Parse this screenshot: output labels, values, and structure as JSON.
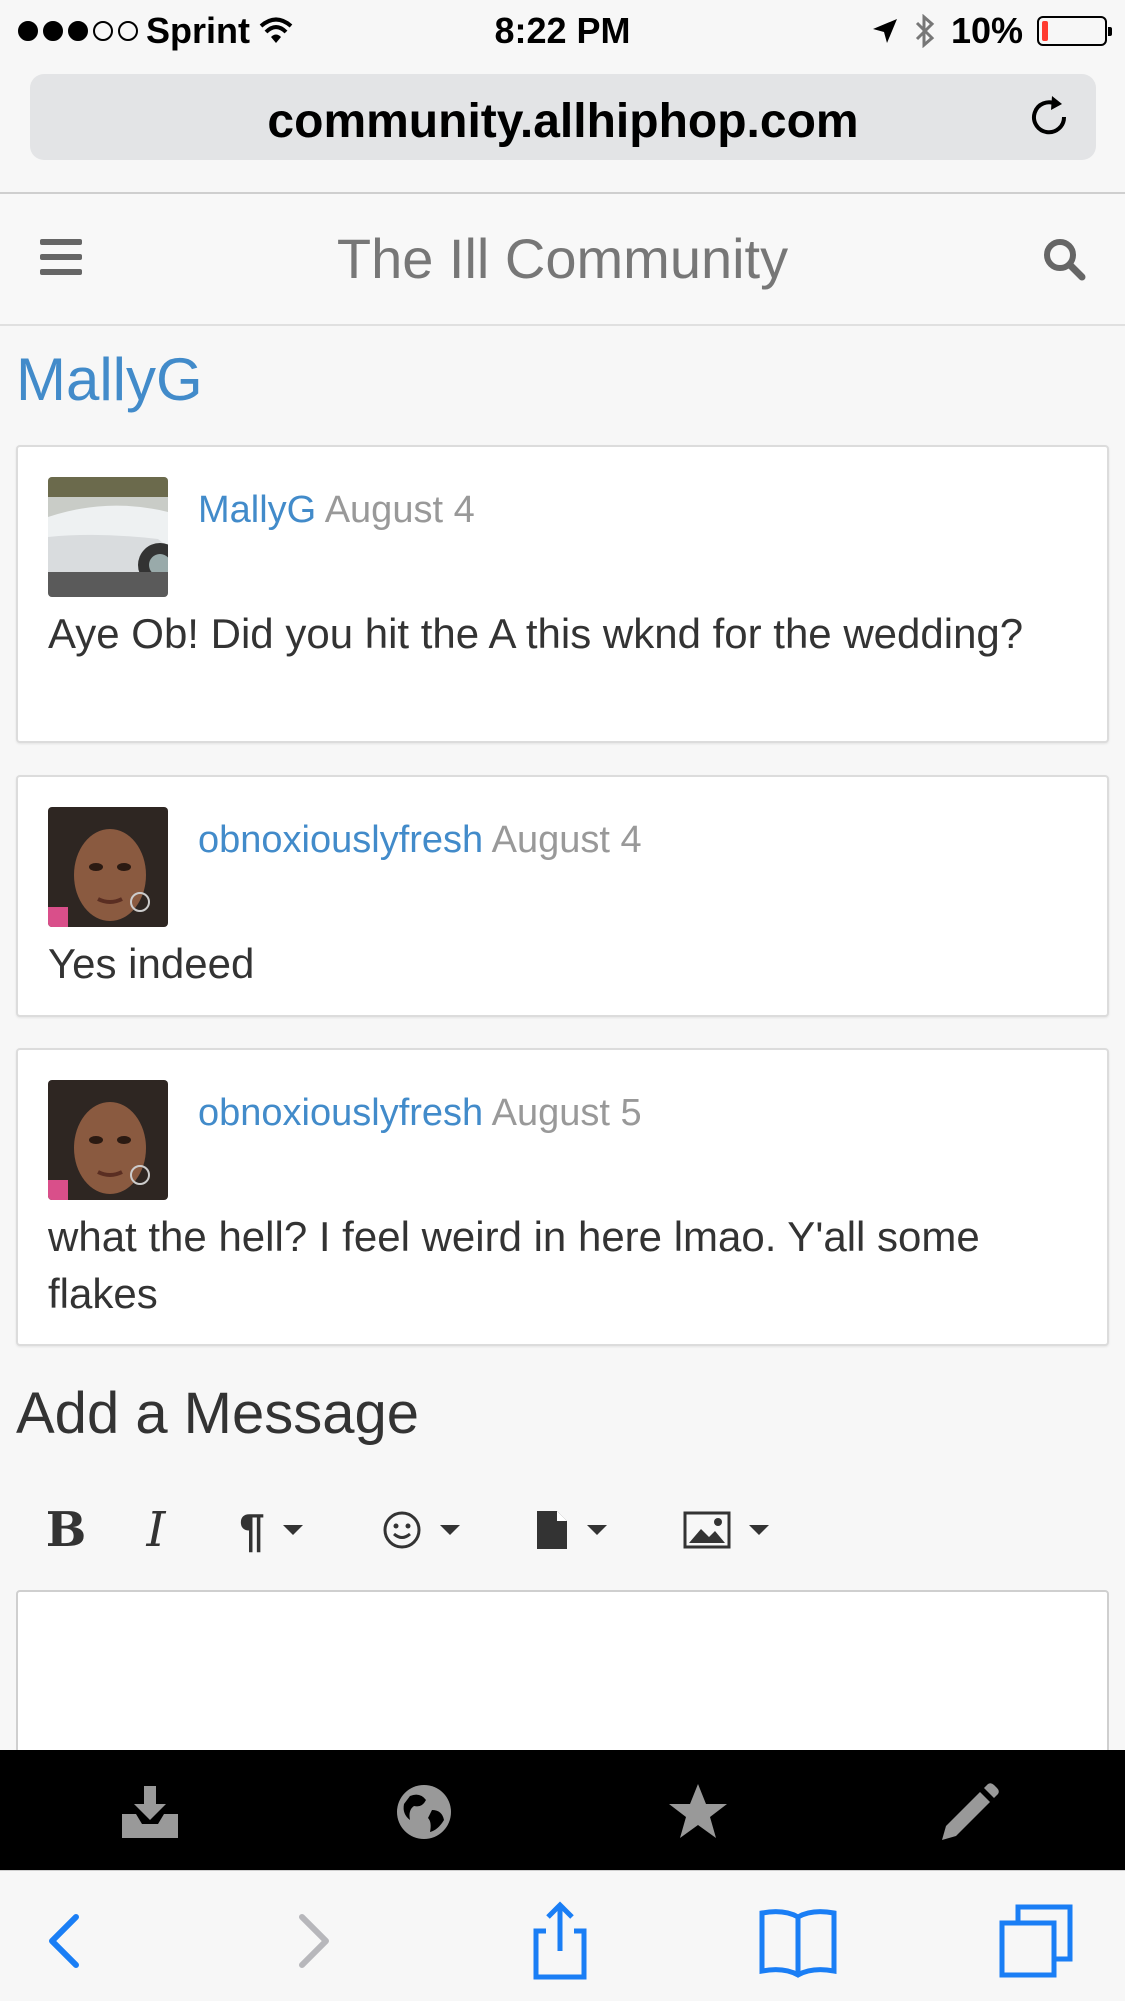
{
  "status_bar": {
    "carrier": "Sprint",
    "time": "8:22 PM",
    "battery_text": "10%",
    "battery_level": 0.1,
    "signal_bars_filled": 3,
    "signal_bars_total": 5
  },
  "browser": {
    "url": "community.allhiphop.com"
  },
  "site_header": {
    "title": "The Ill Community"
  },
  "profile": {
    "name": "MallyG"
  },
  "messages": [
    {
      "user": "MallyG",
      "date": "August 4",
      "body": "Aye Ob! Did you hit the A this wknd for the wedding?"
    },
    {
      "user": "obnoxiouslyfresh",
      "date": "August 4",
      "body": "Yes indeed"
    },
    {
      "user": "obnoxiouslyfresh",
      "date": "August 5",
      "body": "what the hell? I feel weird in here lmao. Y'all some flakes"
    }
  ],
  "compose": {
    "heading": "Add a Message",
    "toolbar": [
      "bold",
      "italic",
      "paragraph",
      "emoji",
      "file",
      "image"
    ]
  },
  "colors": {
    "link": "#428bca",
    "muted": "#999999",
    "text": "#333333",
    "battery_low": "#ff3b30",
    "ios_blue": "#1a7ef5"
  }
}
